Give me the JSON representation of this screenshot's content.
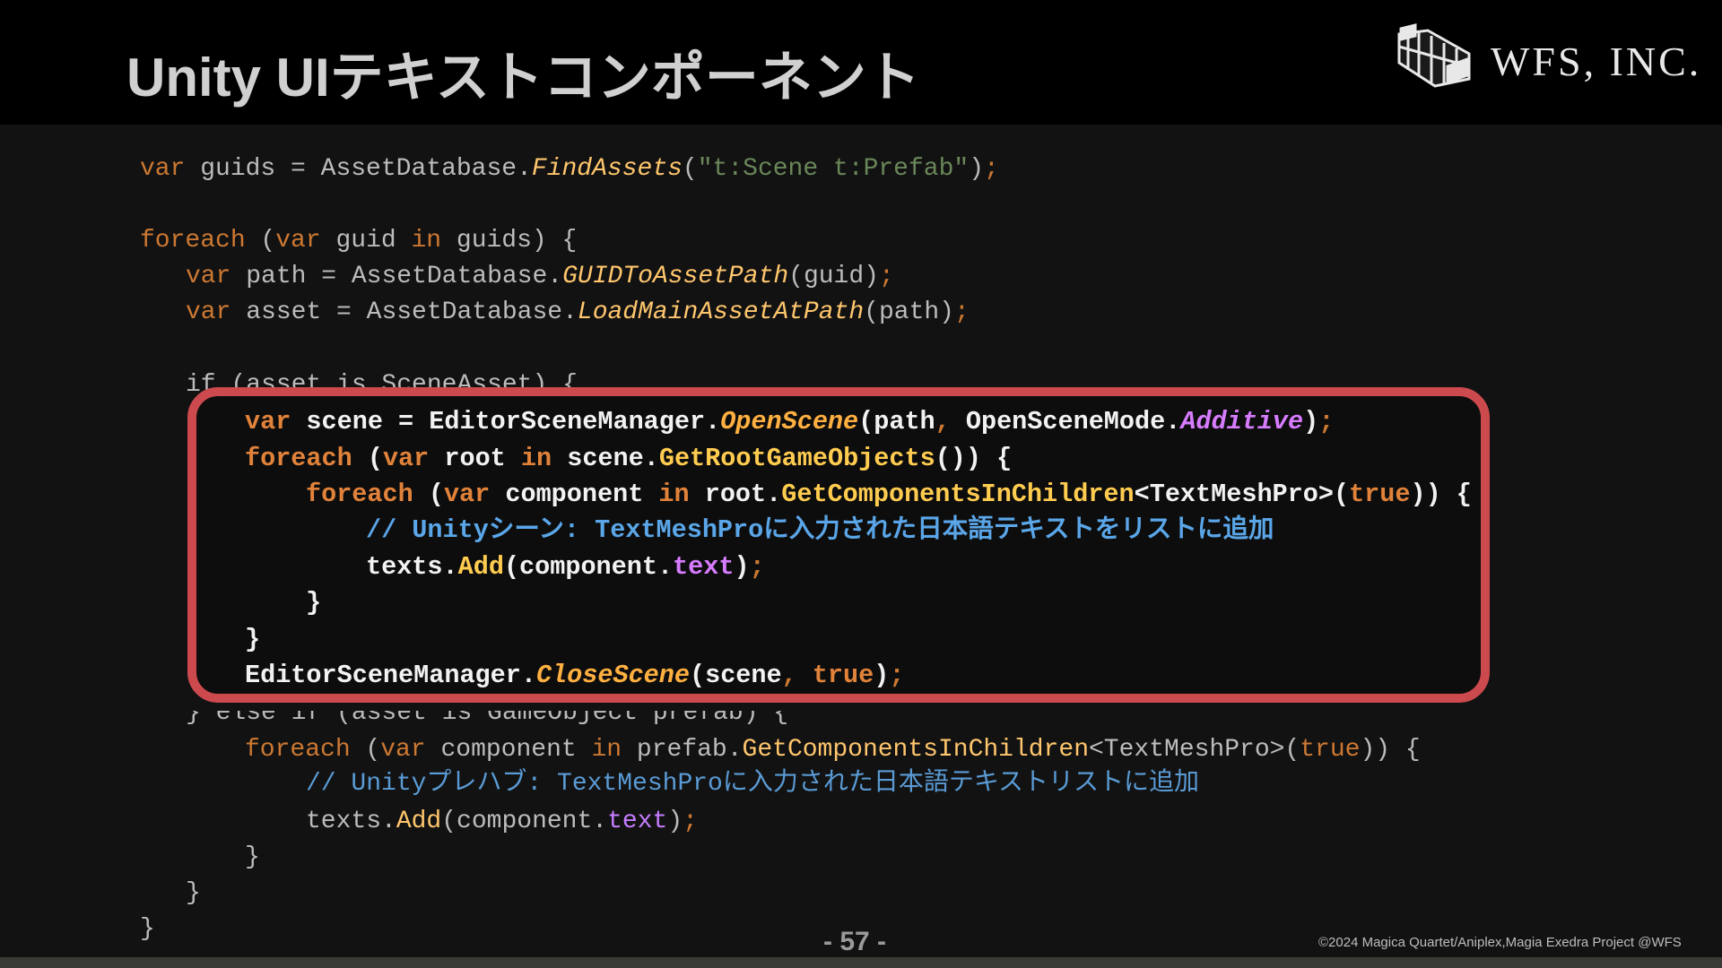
{
  "slide": {
    "title": "Unity UIテキストコンポーネント",
    "company": "WFS, INC.",
    "page_number": "- 57 -",
    "copyright": "©2024 Magica Quartet/Aniplex,Magia Exedra Project @WFS"
  },
  "code": {
    "l1": {
      "a": "var",
      "b": " guids = AssetDatabase.",
      "c": "FindAssets",
      "d": "(",
      "e": "\"t:Scene t:Prefab\"",
      "f": ")",
      "g": ";"
    },
    "l2": {
      "a": "foreach",
      "b": " (",
      "c": "var",
      "d": " guid ",
      "e": "in",
      "f": " guids) {"
    },
    "l3": {
      "a": "var",
      "b": " path = AssetDatabase.",
      "c": "GUIDToAssetPath",
      "d": "(guid)",
      "e": ";"
    },
    "l4": {
      "a": "var",
      "b": " asset = AssetDatabase.",
      "c": "LoadMainAssetAtPath",
      "d": "(path)",
      "e": ";"
    },
    "l5": {
      "text": "if (asset is SceneAsset) {"
    },
    "h1": {
      "a": "var",
      "b": " scene = EditorSceneManager.",
      "c": "OpenScene",
      "d": "(path",
      ",": ",",
      "e": " OpenSceneMode.",
      "f": "Additive",
      "g": ")",
      "h": ";"
    },
    "h2": {
      "a": "foreach",
      "b": " (",
      "c": "var",
      "d": " root ",
      "e": "in",
      "f": " scene.",
      "g": "GetRootGameObjects",
      "h": "()) {"
    },
    "h3": {
      "a": "foreach",
      "b": " (",
      "c": "var",
      "d": " component ",
      "e": "in",
      "f": " root.",
      "g": "GetComponentsInChildren",
      "h": "<TextMeshPro>(",
      "i": "true",
      "j": ")) {"
    },
    "h4": {
      "text": "// Unityシーン: TextMeshProに入力された日本語テキストをリストに追加"
    },
    "h5": {
      "a": "texts.",
      "b": "Add",
      "c": "(component.",
      "d": "text",
      "e": ")",
      "f": ";"
    },
    "h6": {
      "text": "}"
    },
    "h7": {
      "text": "}"
    },
    "h8": {
      "a": "EditorSceneManager.",
      "b": "CloseScene",
      "c": "(scene",
      ",": ",",
      "d": " true",
      "e": ")",
      "f": ";"
    },
    "l6": {
      "text": "} else if (asset is GameObject prefab) {"
    },
    "l7": {
      "a": "foreach",
      "b": " (",
      "c": "var",
      "d": " component ",
      "e": "in",
      "f": " prefab.",
      "g": "GetComponentsInChildren",
      "h": "<TextMeshPro>(",
      "i": "true",
      "j": ")) {"
    },
    "l8": {
      "text": "// Unityプレハブ: TextMeshProに入力された日本語テキストリストに追加"
    },
    "l9": {
      "a": "texts.",
      "b": "Add",
      "c": "(component.",
      "d": "text",
      "e": ")",
      "f": ";"
    },
    "l10": {
      "text": "}"
    },
    "l11": {
      "text": "}"
    },
    "l12": {
      "text": "}"
    }
  },
  "colors": {
    "keyword": "#cc7832",
    "method": "#ffc66d",
    "string": "#6a8759",
    "comment": "#5a9bd5",
    "property": "#c77dff",
    "highlight_border": "#cc4a4e"
  },
  "icons": {
    "logo": "wfs-logo-icon"
  }
}
